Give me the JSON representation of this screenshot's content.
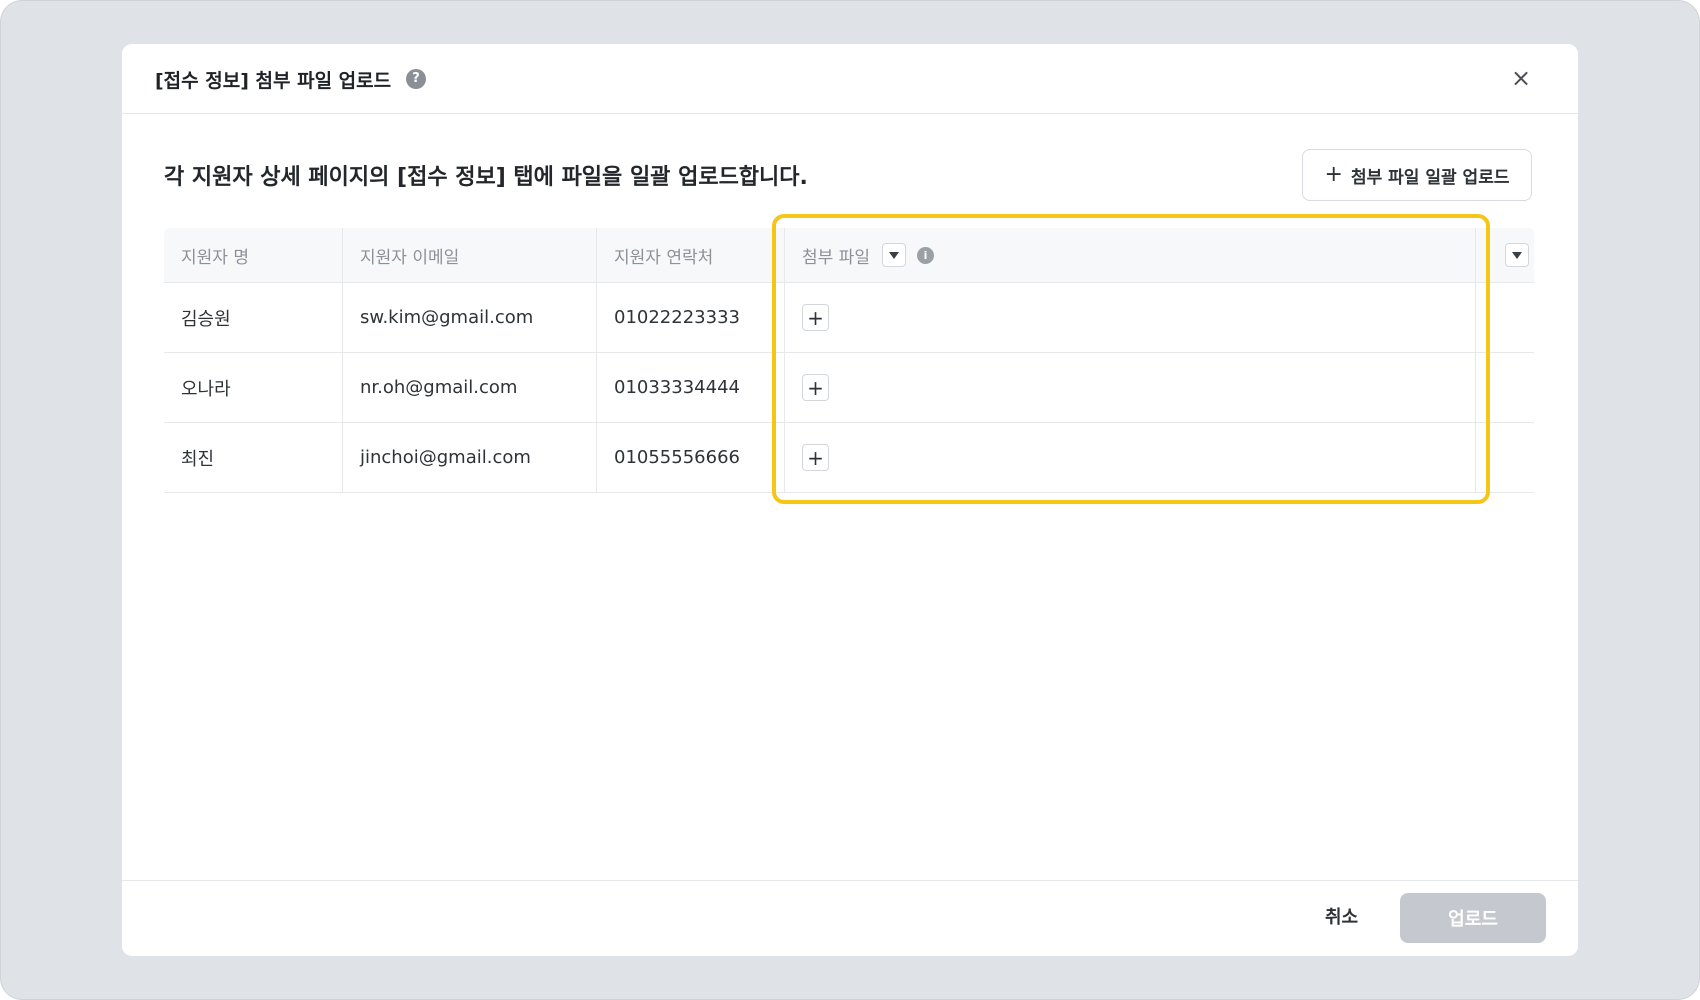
{
  "modal": {
    "title": "[접수 정보] 첨부 파일 업로드",
    "help_icon": "?",
    "close_icon": "×"
  },
  "description": "각 지원자 상세 페이지의 [접수 정보] 탭에 파일을 일괄 업로드합니다.",
  "bulk_upload_button": {
    "icon": "+",
    "label": "첨부 파일 일괄 업로드"
  },
  "table": {
    "headers": [
      "지원자 명",
      "지원자 이메일",
      "지원자 연락처",
      "첨부 파일"
    ],
    "info_icon": "i",
    "rows": [
      {
        "name": "김승원",
        "email": "sw.kim@gmail.com",
        "phone": "01022223333"
      },
      {
        "name": "오나라",
        "email": "nr.oh@gmail.com",
        "phone": "01033334444"
      },
      {
        "name": "최진",
        "email": "jinchoi@gmail.com",
        "phone": "01055556666"
      }
    ],
    "add_icon": "+"
  },
  "footer": {
    "cancel_label": "취소",
    "upload_label": "업로드"
  },
  "colors": {
    "highlight": "#f5c518",
    "upload_disabled": "#c5c9cf",
    "backdrop": "#dfe2e6"
  }
}
